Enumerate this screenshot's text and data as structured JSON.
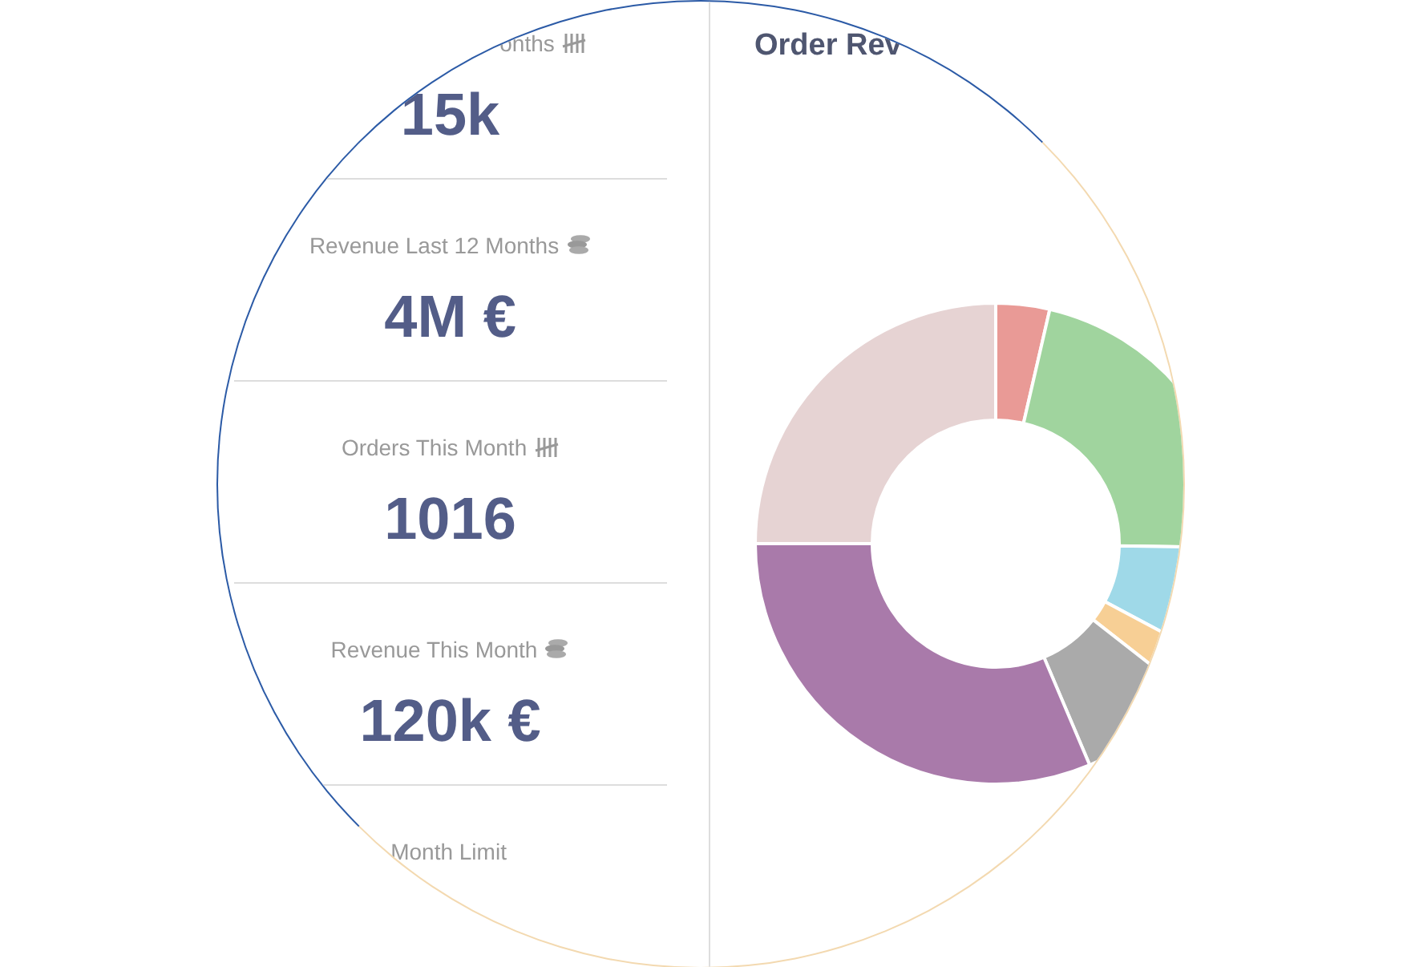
{
  "stats": [
    {
      "label": "onths",
      "kind": "count",
      "value": "15k"
    },
    {
      "label": "Revenue Last 12 Months",
      "kind": "money",
      "value": "4M €"
    },
    {
      "label": "Orders This Month",
      "kind": "count",
      "value": "1016"
    },
    {
      "label": "Revenue This Month",
      "kind": "money",
      "value": "120k €"
    },
    {
      "label": "Month Limit"
    }
  ],
  "chart_panel": {
    "title": "Order Rev"
  }
}
